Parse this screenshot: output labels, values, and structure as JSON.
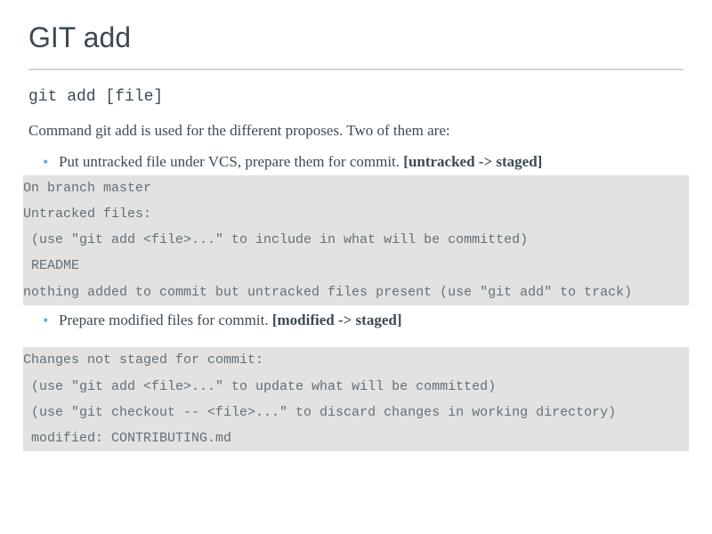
{
  "title": "GIT add",
  "command": "git add [file]",
  "intro": "Command git add is used for the different proposes. Two of them are:",
  "bullet1_text": "Put untracked file under VCS, prepare them for commit. ",
  "bullet1_bold": "[untracked -> staged]",
  "code1": "On branch master\nUntracked files:\n (use \"git add <file>...\" to include in what will be committed)\n README\nnothing added to commit but untracked files present (use \"git add\" to track)",
  "bullet2_text": "Prepare modified files for commit. ",
  "bullet2_bold": "[modified -> staged]",
  "code2": "Changes not staged for commit:\n (use \"git add <file>...\" to update what will be committed)\n (use \"git checkout -- <file>...\" to discard changes in working directory)\n modified: CONTRIBUTING.md"
}
